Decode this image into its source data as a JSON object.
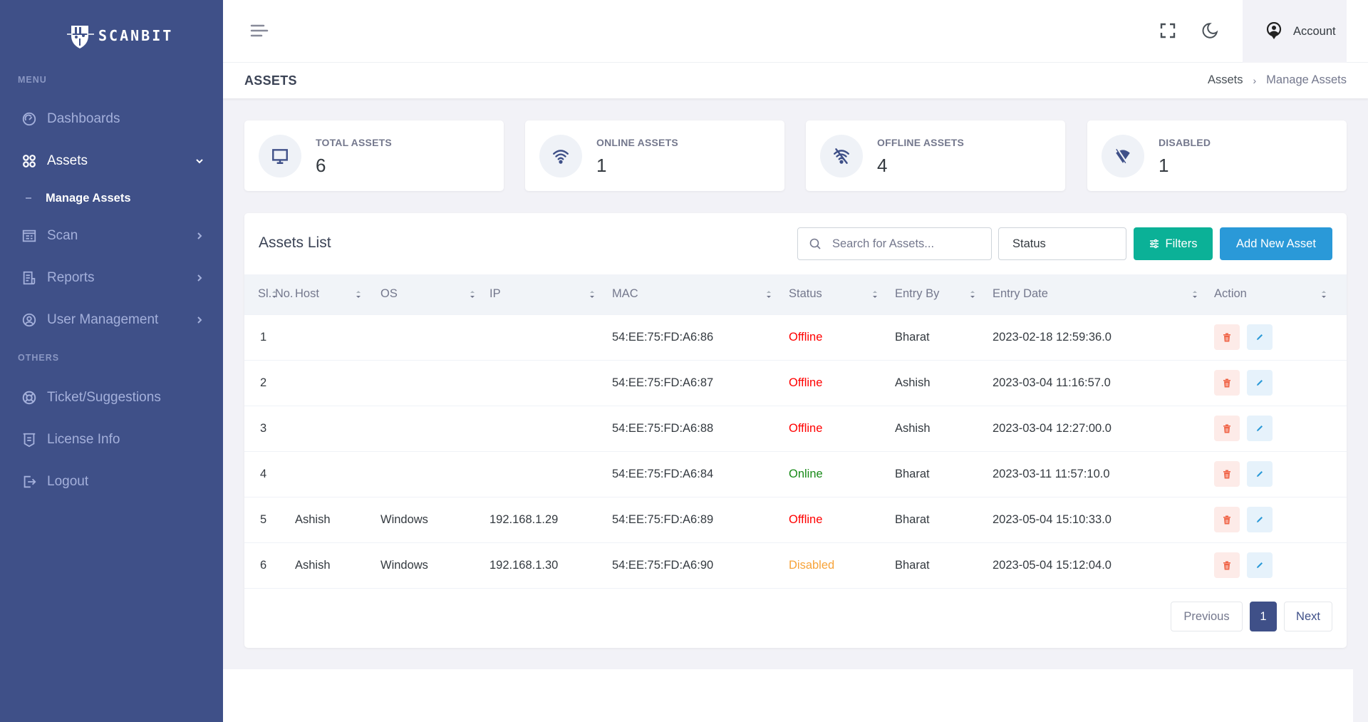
{
  "brand": {
    "name": "SCANBIT"
  },
  "sidebar": {
    "menu_title": "MENU",
    "others_title": "OTHERS",
    "items": [
      {
        "label": "Dashboards",
        "icon": "speedometer-icon"
      },
      {
        "label": "Assets",
        "icon": "apps-icon",
        "expanded": true
      },
      {
        "label": "Scan",
        "icon": "scan-icon"
      },
      {
        "label": "Reports",
        "icon": "report-icon"
      },
      {
        "label": "User Management",
        "icon": "user-circle-icon"
      },
      {
        "label": "Ticket/Suggestions",
        "icon": "lifebuoy-icon"
      },
      {
        "label": "License Info",
        "icon": "license-icon"
      },
      {
        "label": "Logout",
        "icon": "logout-icon"
      }
    ],
    "sub_items": [
      {
        "label": "Manage Assets",
        "active": true
      }
    ]
  },
  "header": {
    "account_label": "Account"
  },
  "page": {
    "title": "ASSETS",
    "breadcrumb": [
      "Assets",
      "Manage Assets"
    ],
    "breadcrumb_sep": "›"
  },
  "stats": [
    {
      "label": "TOTAL ASSETS",
      "value": "6",
      "icon": "monitor-icon"
    },
    {
      "label": "ONLINE ASSETS",
      "value": "1",
      "icon": "wifi-icon"
    },
    {
      "label": "OFFLINE ASSETS",
      "value": "4",
      "icon": "wifi-off-icon"
    },
    {
      "label": "DISABLED",
      "value": "1",
      "icon": "signal-off-icon"
    }
  ],
  "assets_list": {
    "title": "Assets List",
    "search_placeholder": "Search for Assets...",
    "search_value": "",
    "status_select": "Status",
    "filters_label": "Filters",
    "add_label": "Add New Asset",
    "columns": [
      "Sl. No.",
      "Host",
      "OS",
      "IP",
      "MAC",
      "Status",
      "Entry By",
      "Entry Date",
      "Action"
    ],
    "rows": [
      {
        "sl": "1",
        "host": "",
        "os": "",
        "ip": "",
        "mac": "54:EE:75:FD:A6:86",
        "status": "Offline",
        "entry_by": "Bharat",
        "entry_date": "2023-02-18 12:59:36.0"
      },
      {
        "sl": "2",
        "host": "",
        "os": "",
        "ip": "",
        "mac": "54:EE:75:FD:A6:87",
        "status": "Offline",
        "entry_by": "Ashish",
        "entry_date": "2023-03-04 11:16:57.0"
      },
      {
        "sl": "3",
        "host": "",
        "os": "",
        "ip": "",
        "mac": "54:EE:75:FD:A6:88",
        "status": "Offline",
        "entry_by": "Ashish",
        "entry_date": "2023-03-04 12:27:00.0"
      },
      {
        "sl": "4",
        "host": "",
        "os": "",
        "ip": "",
        "mac": "54:EE:75:FD:A6:84",
        "status": "Online",
        "entry_by": "Bharat",
        "entry_date": "2023-03-11 11:57:10.0"
      },
      {
        "sl": "5",
        "host": "Ashish",
        "os": "Windows",
        "ip": "192.168.1.29",
        "mac": "54:EE:75:FD:A6:89",
        "status": "Offline",
        "entry_by": "Bharat",
        "entry_date": "2023-05-04 15:10:33.0"
      },
      {
        "sl": "6",
        "host": "Ashish",
        "os": "Windows",
        "ip": "192.168.1.30",
        "mac": "54:EE:75:FD:A6:90",
        "status": "Disabled",
        "entry_by": "Bharat",
        "entry_date": "2023-05-04 15:12:04.0"
      }
    ],
    "pagination": {
      "previous": "Previous",
      "current": "1",
      "next": "Next"
    }
  },
  "colors": {
    "sidebar_bg": "#3f5088",
    "primary": "#3f5088",
    "success": "#0bb197",
    "info": "#2a99d8",
    "offline": "#ff0000",
    "online": "#188a18",
    "disabled": "#f7a339"
  }
}
